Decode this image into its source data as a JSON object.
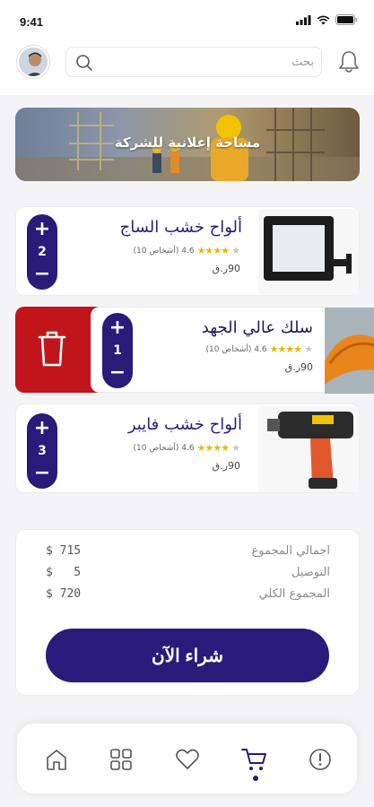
{
  "status_bar": {
    "time": "9:41"
  },
  "header": {
    "search_placeholder": "بحث"
  },
  "banner": {
    "text": "مساحة إعلانية للشركة"
  },
  "cart_items": [
    {
      "name": "ألواح خشب الساج",
      "rating": "4.6",
      "reviews": "(أشخاص 10)",
      "price": "90ر.ق",
      "quantity": "2",
      "stars_filled": 4
    },
    {
      "name": "سلك عالي الجهد",
      "rating": "4.6",
      "reviews": "(أشخاص 10)",
      "price": "90ر.ق",
      "quantity": "1",
      "stars_filled": 4
    },
    {
      "name": "ألواح خشب فايبر",
      "rating": "4.6",
      "reviews": "(أشخاص 10)",
      "price": "90ر.ق",
      "quantity": "3",
      "stars_filled": 4
    }
  ],
  "stepper": {
    "plus": "+",
    "minus": "−"
  },
  "summary": {
    "subtotal_label": "اجمالي المجموع",
    "subtotal_value": "$ 715",
    "delivery_label": "التوصيل",
    "delivery_value": "$   5",
    "total_label": "المجموع الكلي",
    "total_value": "$ 720"
  },
  "buy_button": {
    "label": "شراء الآن"
  },
  "nav": {
    "items": [
      "home-icon",
      "grid-icon",
      "heart-icon",
      "cart-icon",
      "info-icon"
    ],
    "active": "cart-icon"
  },
  "colors": {
    "primary": "#2a1a7a",
    "delete": "#c0161b",
    "star": "#f4b400"
  }
}
